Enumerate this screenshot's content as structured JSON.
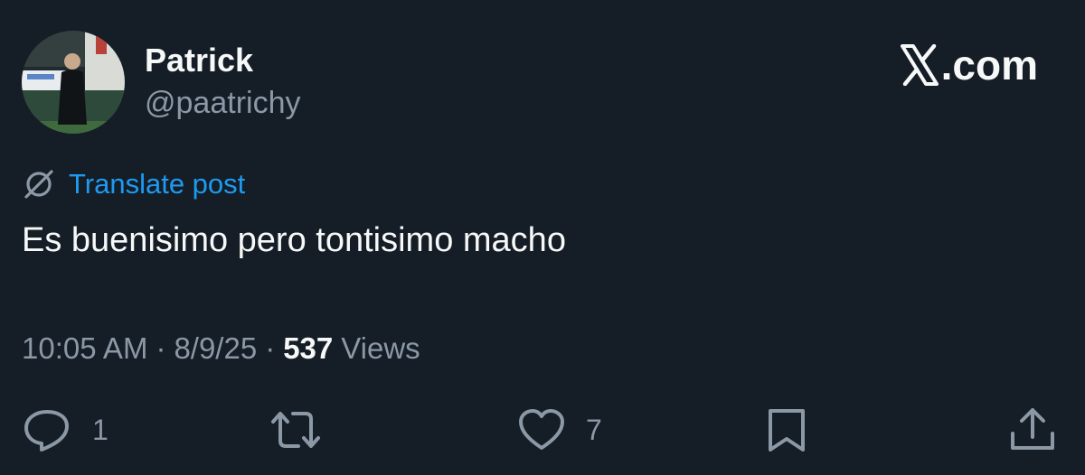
{
  "author": {
    "display_name": "Patrick",
    "handle": "@paatrichy"
  },
  "brand": {
    "name": ".com"
  },
  "translate": {
    "label": "Translate post",
    "icon": "globe-off-icon"
  },
  "post": {
    "text": "Es buenisimo pero tontisimo macho"
  },
  "meta": {
    "time": "10:05 AM",
    "separator": "·",
    "date": "8/9/25",
    "views_count": "537",
    "views_label": "Views"
  },
  "actions": {
    "reply": {
      "icon": "reply-icon",
      "count": "1"
    },
    "repost": {
      "icon": "repost-icon",
      "count": ""
    },
    "like": {
      "icon": "heart-icon",
      "count": "7"
    },
    "bookmark": {
      "icon": "bookmark-icon",
      "count": ""
    },
    "share": {
      "icon": "share-icon",
      "count": ""
    }
  },
  "colors": {
    "background": "#151d27",
    "primary_text": "#f7f9f9",
    "secondary_text": "#8b98a5",
    "link": "#1d9bf0"
  }
}
